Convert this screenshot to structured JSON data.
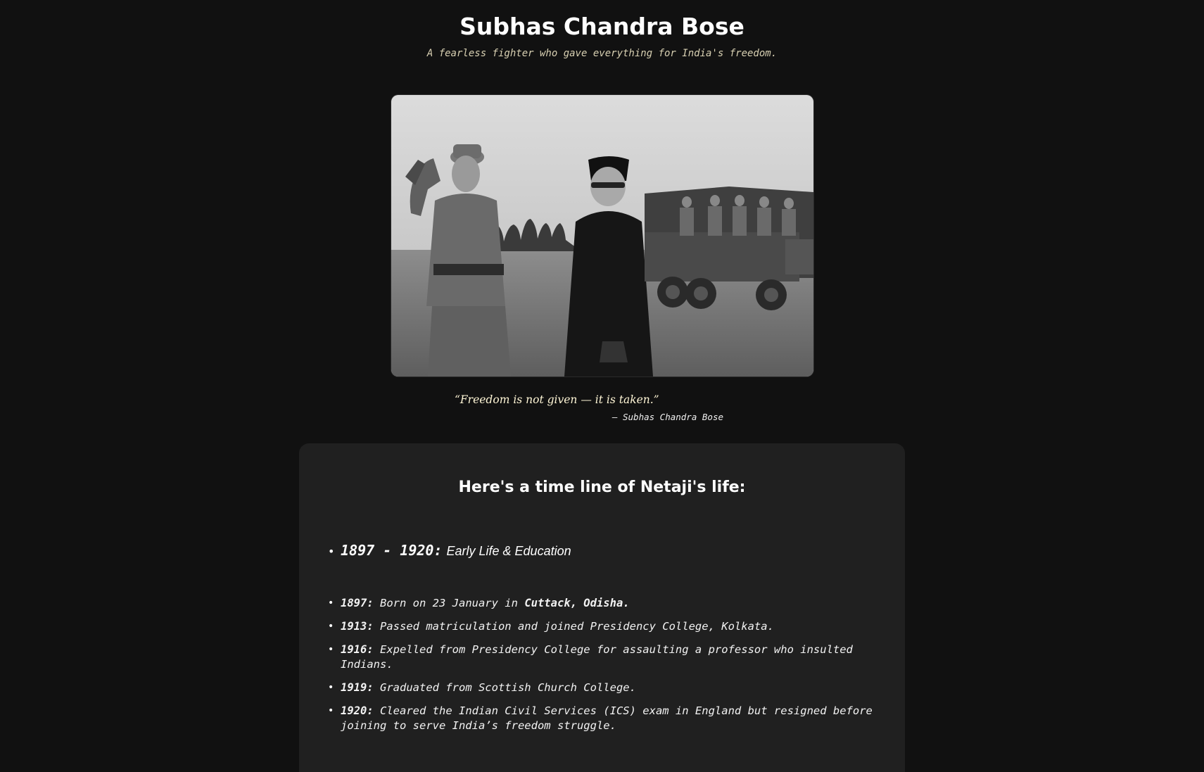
{
  "header": {
    "title": "Subhas Chandra Bose",
    "subtitle": "A fearless fighter who gave everything for India's freedom."
  },
  "quote": {
    "text": "“Freedom is not given — it is taken.”",
    "attribution": "— Subhas Chandra Bose"
  },
  "timeline": {
    "heading": "Here's a time line of Netaji's life:",
    "period": {
      "years": "1897 - 1920",
      "colon": ":",
      "title": "Early Life & Education"
    },
    "events": [
      {
        "year": "1897:",
        "text": " Born on 23 January in ",
        "strong": "Cuttack, Odisha.",
        "after": ""
      },
      {
        "year": "1913:",
        "text": " Passed matriculation and joined Presidency College, Kolkata.",
        "strong": "",
        "after": ""
      },
      {
        "year": "1916:",
        "text": " Expelled from Presidency College for assaulting a professor who insulted Indians.",
        "strong": "",
        "after": ""
      },
      {
        "year": "1919:",
        "text": " Graduated from Scottish Church College.",
        "strong": "",
        "after": ""
      },
      {
        "year": "1920:",
        "text": " Cleared the Indian Civil Services (ICS) exam in England but resigned before joining to serve India’s freedom struggle.",
        "strong": "",
        "after": ""
      }
    ]
  },
  "colors": {
    "background": "#111111",
    "card": "#202020",
    "subtitle": "#d8d0b2",
    "quote": "#fff6d6"
  }
}
